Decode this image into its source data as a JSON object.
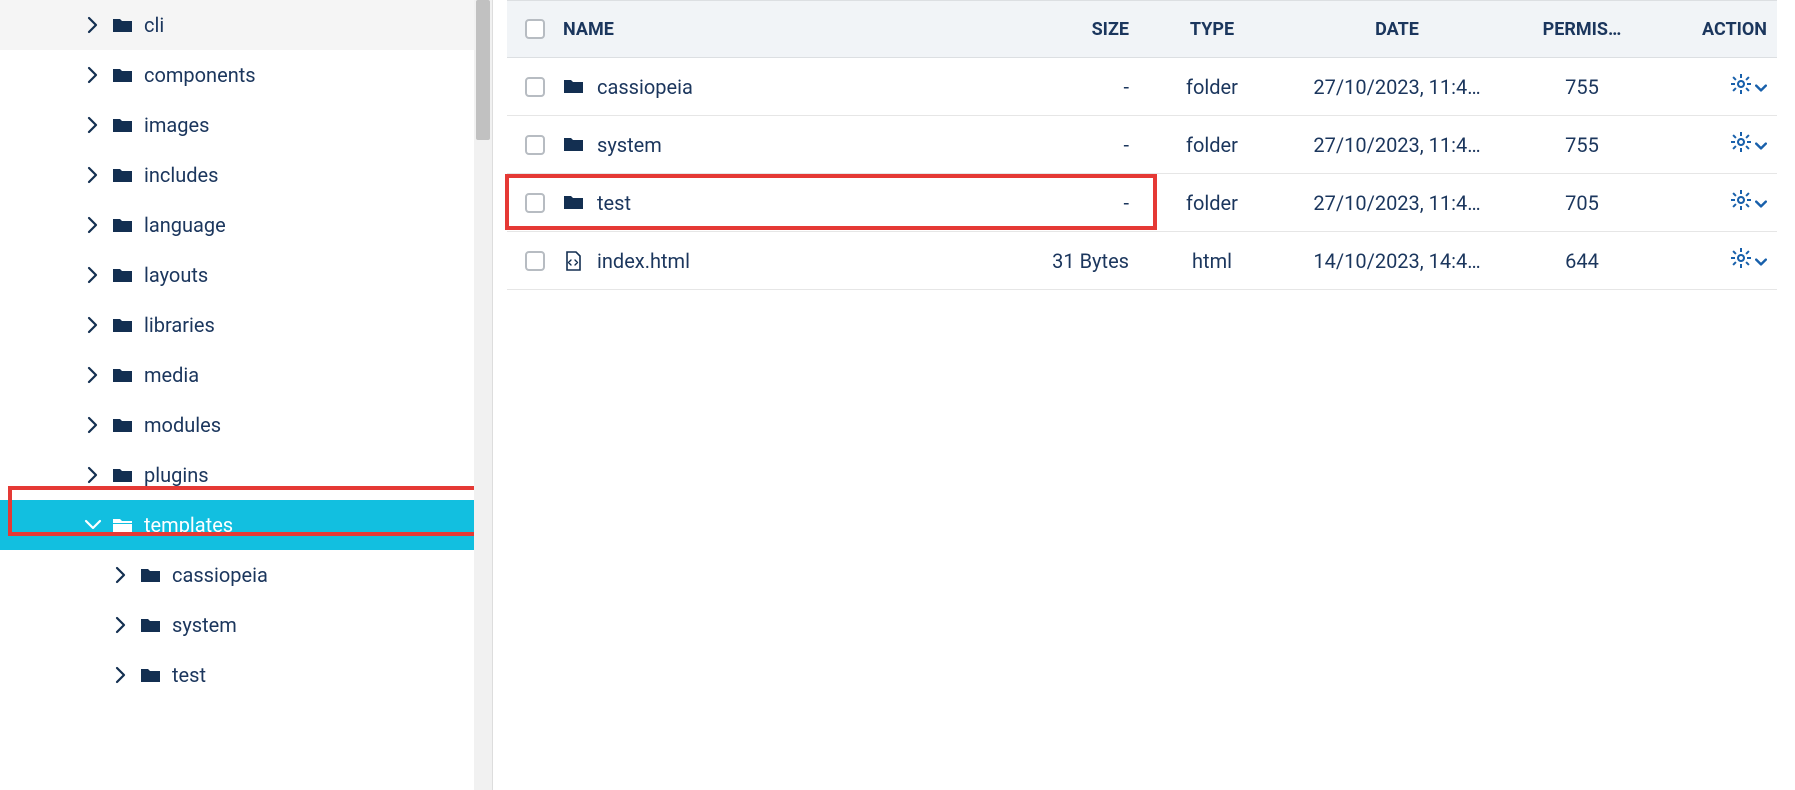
{
  "sidebar": {
    "items": [
      {
        "label": "cli",
        "level": 1,
        "expanded": false,
        "selected": false
      },
      {
        "label": "components",
        "level": 1,
        "expanded": false,
        "selected": false
      },
      {
        "label": "images",
        "level": 1,
        "expanded": false,
        "selected": false
      },
      {
        "label": "includes",
        "level": 1,
        "expanded": false,
        "selected": false
      },
      {
        "label": "language",
        "level": 1,
        "expanded": false,
        "selected": false
      },
      {
        "label": "layouts",
        "level": 1,
        "expanded": false,
        "selected": false
      },
      {
        "label": "libraries",
        "level": 1,
        "expanded": false,
        "selected": false
      },
      {
        "label": "media",
        "level": 1,
        "expanded": false,
        "selected": false
      },
      {
        "label": "modules",
        "level": 1,
        "expanded": false,
        "selected": false
      },
      {
        "label": "plugins",
        "level": 1,
        "expanded": false,
        "selected": false
      },
      {
        "label": "templates",
        "level": 1,
        "expanded": true,
        "selected": true
      },
      {
        "label": "cassiopeia",
        "level": 2,
        "expanded": false,
        "selected": false
      },
      {
        "label": "system",
        "level": 2,
        "expanded": false,
        "selected": false
      },
      {
        "label": "test",
        "level": 2,
        "expanded": false,
        "selected": false
      }
    ]
  },
  "table": {
    "headers": {
      "name": "NAME",
      "size": "SIZE",
      "type": "TYPE",
      "date": "DATE",
      "permis": "PERMIS…",
      "action": "ACTION"
    },
    "rows": [
      {
        "name": "cassiopeia",
        "icon": "folder",
        "size": "-",
        "type": "folder",
        "date": "27/10/2023, 11:4…",
        "permis": "755",
        "highlighted": false
      },
      {
        "name": "system",
        "icon": "folder",
        "size": "-",
        "type": "folder",
        "date": "27/10/2023, 11:4…",
        "permis": "755",
        "highlighted": false
      },
      {
        "name": "test",
        "icon": "folder",
        "size": "-",
        "type": "folder",
        "date": "27/10/2023, 11:4…",
        "permis": "705",
        "highlighted": true
      },
      {
        "name": "index.html",
        "icon": "file",
        "size": "31 Bytes",
        "type": "html",
        "date": "14/10/2023, 14:4…",
        "permis": "644",
        "highlighted": false
      }
    ]
  },
  "colors": {
    "accent": "#12bfe0",
    "dark": "#1b365d",
    "highlight_border": "#e53935",
    "action_blue": "#1860ab"
  }
}
